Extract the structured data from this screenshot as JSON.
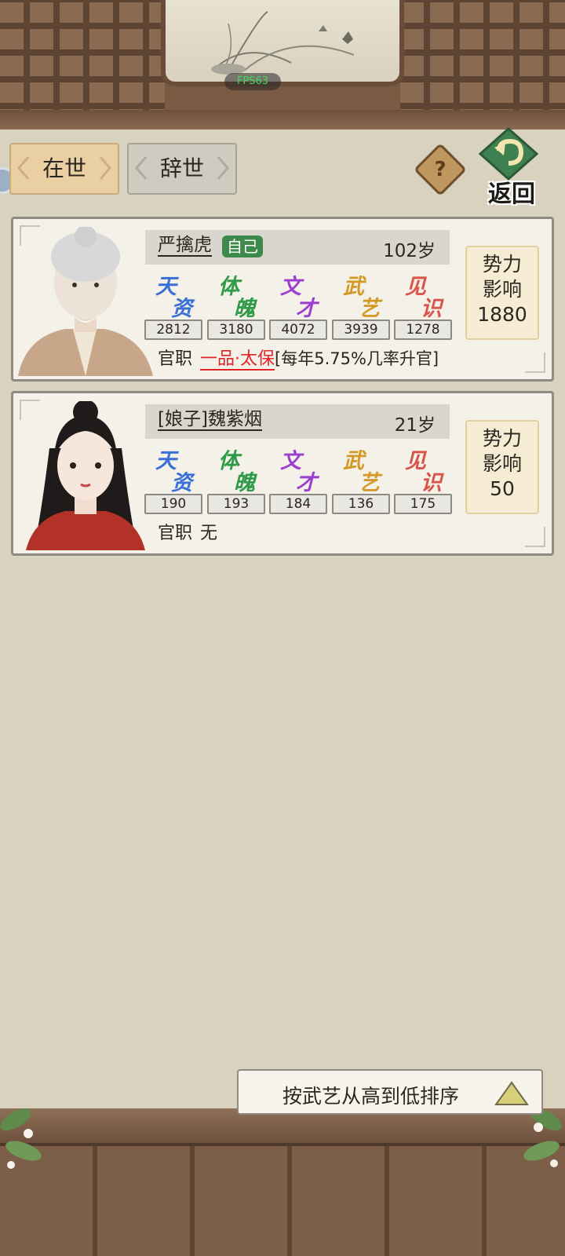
{
  "header": {
    "fps": "FPS63",
    "back_label": "返回",
    "help_label": "?"
  },
  "tabs": [
    {
      "label": "在世",
      "active": true
    },
    {
      "label": "辞世",
      "active": false
    }
  ],
  "stat_labels": [
    {
      "top": "天",
      "bottom": "资",
      "color": "#3a6fd8"
    },
    {
      "top": "体",
      "bottom": "魄",
      "color": "#2f9a48"
    },
    {
      "top": "文",
      "bottom": "才",
      "color": "#9b3fcf"
    },
    {
      "top": "武",
      "bottom": "艺",
      "color": "#d39a2a"
    },
    {
      "top": "见",
      "bottom": "识",
      "color": "#d9544a"
    }
  ],
  "members": [
    {
      "name": "严擒虎",
      "badge": "自己",
      "age": "102岁",
      "stats": [
        "2812",
        "3180",
        "4072",
        "3939",
        "1278"
      ],
      "office_label": "官职",
      "office_rank": "一品·太保",
      "office_note": "[每年5.75%几率升官]",
      "influence_label_1": "势力",
      "influence_label_2": "影响",
      "influence_value": "1880"
    },
    {
      "name": "[娘子]魏紫烟",
      "age": "21岁",
      "stats": [
        "190",
        "193",
        "184",
        "136",
        "175"
      ],
      "office_label": "官职",
      "office_rank": "无",
      "influence_label_1": "势力",
      "influence_label_2": "影响",
      "influence_value": "50"
    }
  ],
  "sort": {
    "label": "按武艺从高到低排序"
  }
}
